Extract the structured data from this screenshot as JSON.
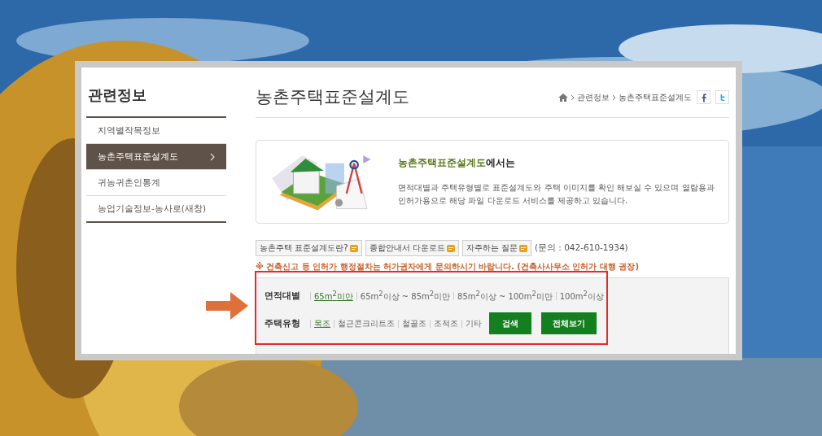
{
  "sidebar": {
    "title": "관련정보",
    "items": [
      {
        "label": "지역별작목정보",
        "selected": false
      },
      {
        "label": "농촌주택표준설계도",
        "selected": true
      },
      {
        "label": "귀농귀촌인통계",
        "selected": false
      },
      {
        "label": "농업기술정보-농사로(새창)",
        "selected": false
      }
    ]
  },
  "header": {
    "title": "농촌주택표준설계도",
    "breadcrumb": [
      "관련정보",
      "농촌주택표준설계도"
    ]
  },
  "intro": {
    "heading_highlight": "농촌주택표준설계도",
    "heading_rest": "에서는",
    "text": "면적대별과 주택유형별로 표준설계도와 주택 이미지를 확인 해보실 수 있으며 열람용과 인허가용으로 해당 파일 다운로드 서비스를 제공하고 있습니다."
  },
  "links": [
    {
      "label": "농촌주택 표준설계도란?"
    },
    {
      "label": "종합안내서 다운로드"
    },
    {
      "label": "자주하는 질문"
    }
  ],
  "contact": "(문의 : 042-610-1934)",
  "notice": "※ 건축신고 등 인허가 행정절차는 허가권자에게 문의하시기 바랍니다. (건축사사무소 인허가 대행 권장)",
  "filters": [
    {
      "label": "면적대별",
      "options": [
        {
          "label": "65m$^{2}$미만",
          "selected": true
        },
        {
          "label": "65m$^{2}$이상 ~ 85m$^{2}$미만",
          "selected": false
        },
        {
          "label": "85m$^{2}$이상 ~ 100m$^{2}$미만",
          "selected": false
        },
        {
          "label": "100m$^{2}$이상",
          "selected": false
        }
      ]
    },
    {
      "label": "주택유형",
      "options": [
        {
          "label": "목조",
          "selected": true
        },
        {
          "label": "철근콘크리트조",
          "selected": false
        },
        {
          "label": "철골조",
          "selected": false
        },
        {
          "label": "조적조",
          "selected": false
        },
        {
          "label": "기타",
          "selected": false
        }
      ]
    }
  ],
  "actions": [
    "검색",
    "전체보기"
  ]
}
